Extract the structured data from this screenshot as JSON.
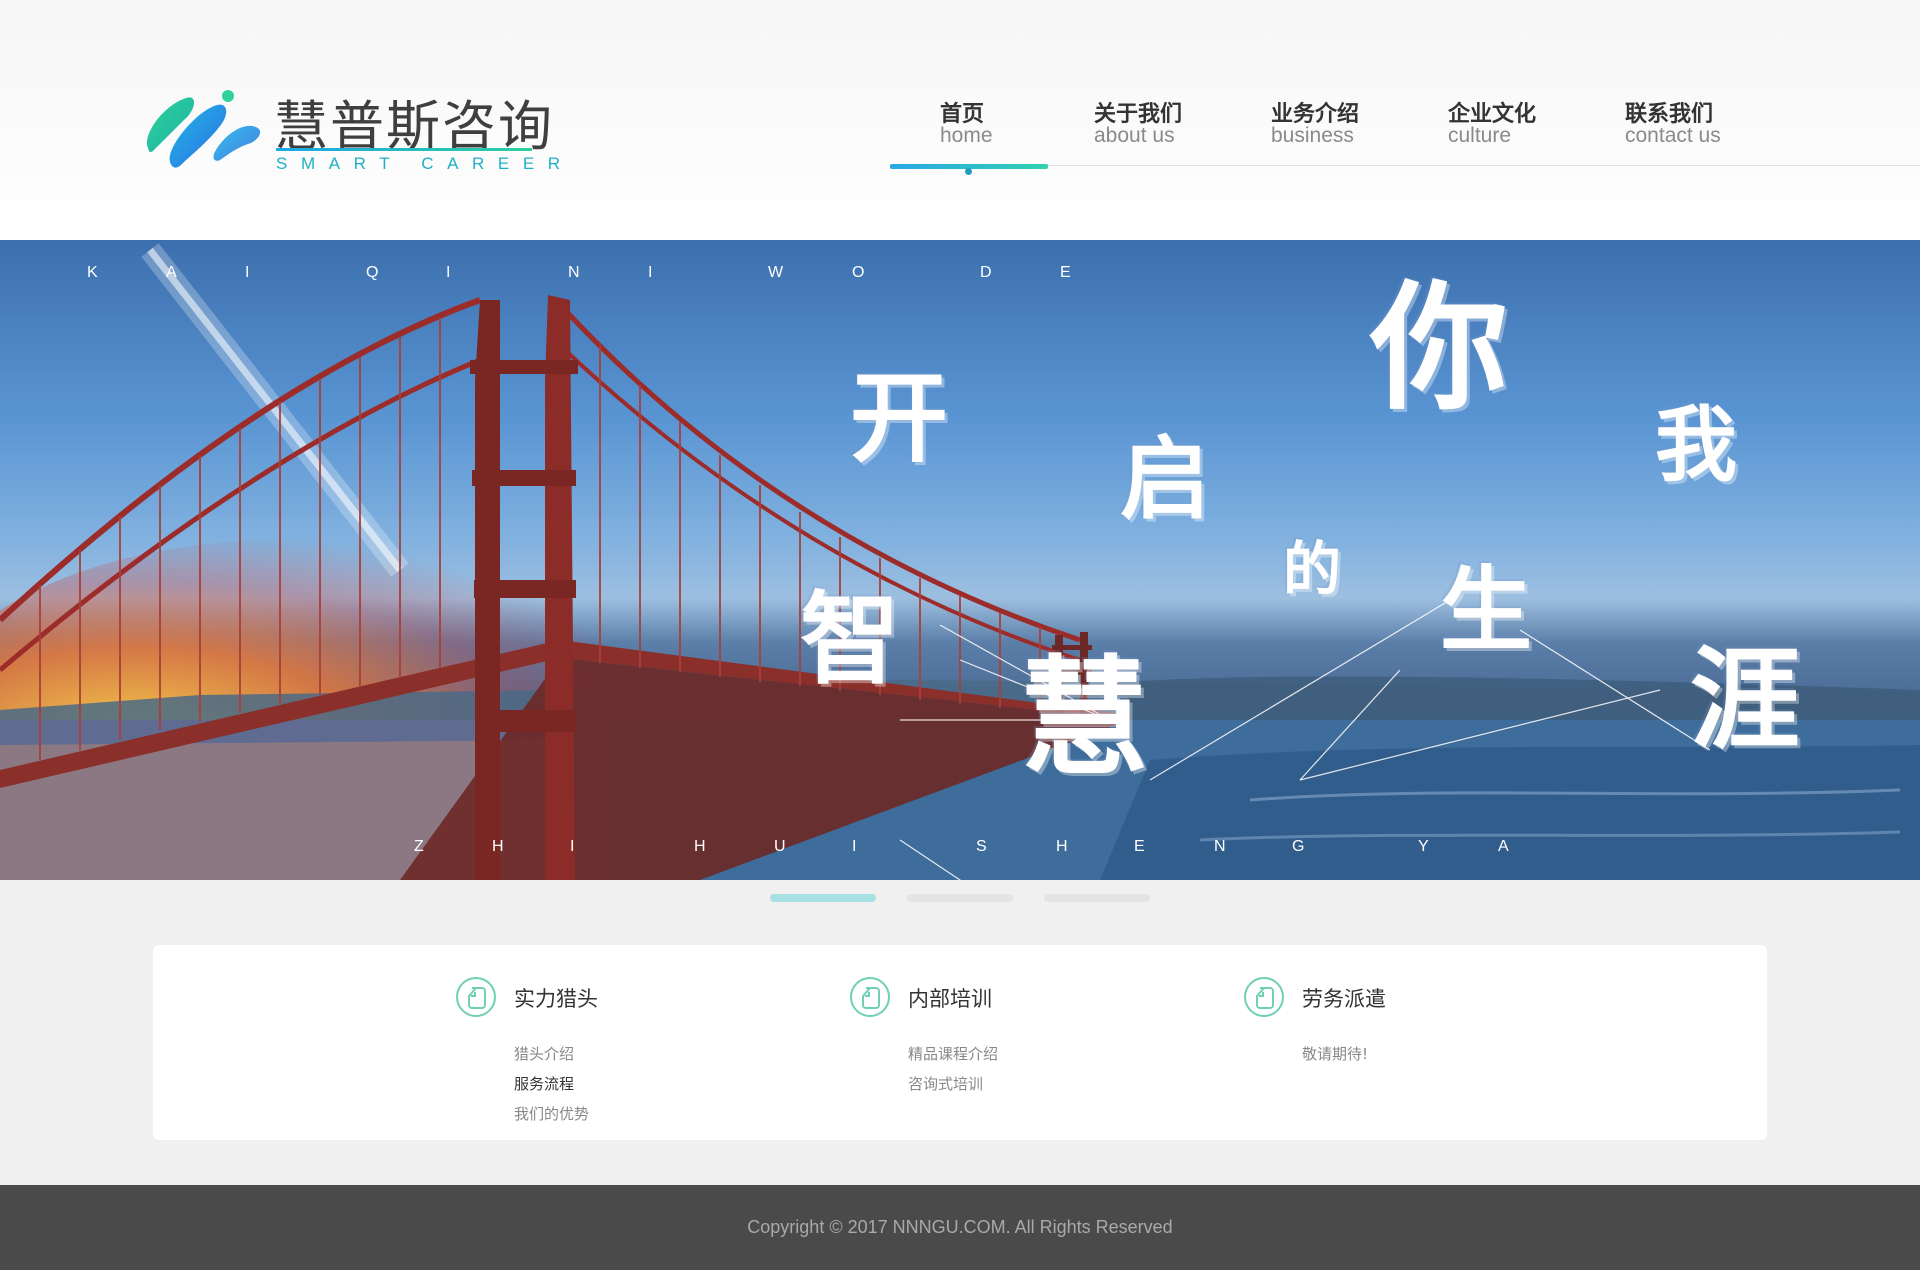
{
  "brand": {
    "name_cn": "慧普斯咨询",
    "name_en": "SMART CAREER",
    "colors": {
      "primary": "#2aa7e6",
      "secondary": "#2fd2b0",
      "text": "#333333"
    }
  },
  "nav": {
    "items": [
      {
        "cn": "首页",
        "en": "home",
        "active": true
      },
      {
        "cn": "关于我们",
        "en": "about us",
        "active": false
      },
      {
        "cn": "业务介绍",
        "en": "business",
        "active": false
      },
      {
        "cn": "企业文化",
        "en": "culture",
        "active": false
      },
      {
        "cn": "联系我们",
        "en": "contact us",
        "active": false
      }
    ]
  },
  "banner": {
    "top_letters": [
      "K",
      "A",
      "I",
      "Q",
      "I",
      "N",
      "I",
      "W",
      "O",
      "D",
      "E"
    ],
    "bottom_letters": [
      "Z",
      "H",
      "I",
      "H",
      "U",
      "I",
      "S",
      "H",
      "E",
      "N",
      "G",
      "Y",
      "A"
    ],
    "words": [
      "开",
      "启",
      "你",
      "我",
      "的",
      "智",
      "慧",
      "生",
      "涯"
    ],
    "slides": {
      "count": 3,
      "active": 1
    }
  },
  "services": [
    {
      "title": "实力猎头",
      "icon": "document-icon",
      "links": [
        {
          "label": "猎头介绍",
          "highlight": false
        },
        {
          "label": "服务流程",
          "highlight": true
        },
        {
          "label": "我们的优势",
          "highlight": false
        }
      ]
    },
    {
      "title": "内部培训",
      "icon": "document-icon",
      "links": [
        {
          "label": "精品课程介绍",
          "highlight": false
        },
        {
          "label": "咨询式培训",
          "highlight": false
        }
      ]
    },
    {
      "title": "劳务派遣",
      "icon": "document-icon",
      "links": [
        {
          "label": "敬请期待!",
          "highlight": false
        }
      ]
    }
  ],
  "footer": {
    "copyright": "Copyright © 2017 NNNGU.COM. All Rights Reserved"
  }
}
